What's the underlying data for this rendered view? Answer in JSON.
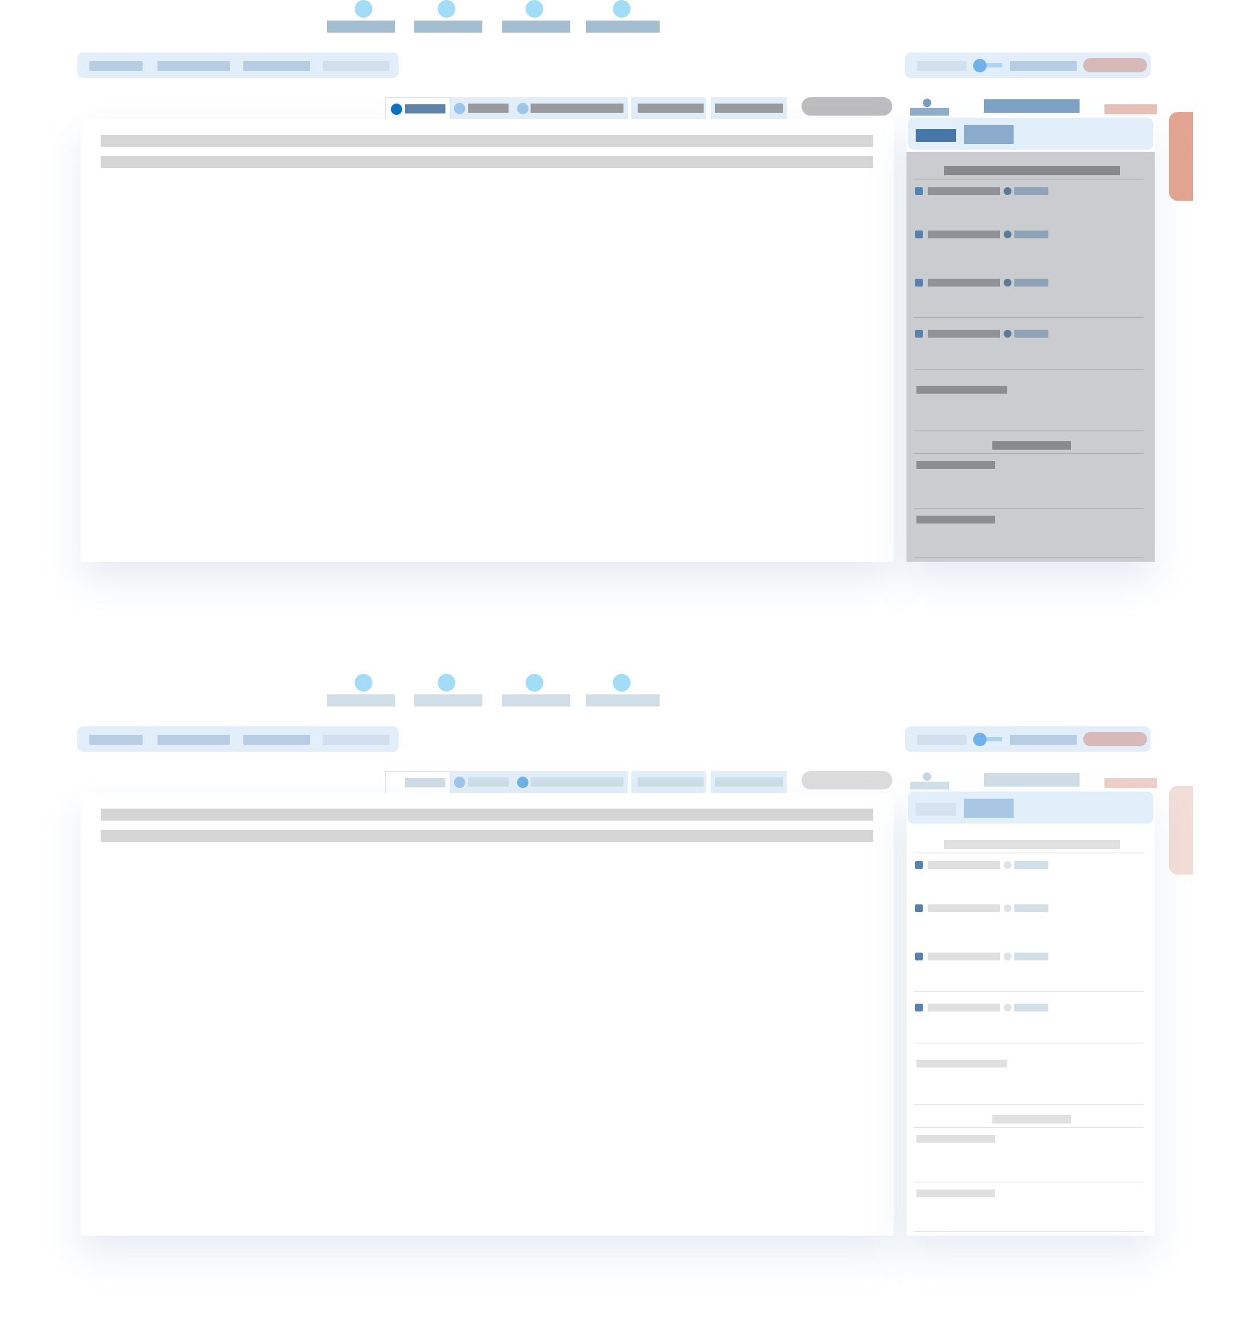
{
  "colors": {
    "accent_blue": "#0a73c5",
    "step_dot": "#a3dcf7",
    "panel_bg": "#ffffff",
    "toolbar_bg": "#e2eefa",
    "sidebar_overlay": "#cbcccf",
    "close_tab": "#e3a491"
  },
  "frames": [
    {
      "state": "active",
      "overlay": true
    },
    {
      "state": "faded",
      "overlay": false
    }
  ],
  "icons": {
    "step": "circle-icon",
    "tab_status": "dot-icon",
    "row_checkbox": "checkbox-icon",
    "row_status": "dot-icon",
    "avatar": "user-icon"
  },
  "stepper": {
    "count": 4
  },
  "sidebar": {
    "row_count": 4,
    "field_count": 3
  }
}
